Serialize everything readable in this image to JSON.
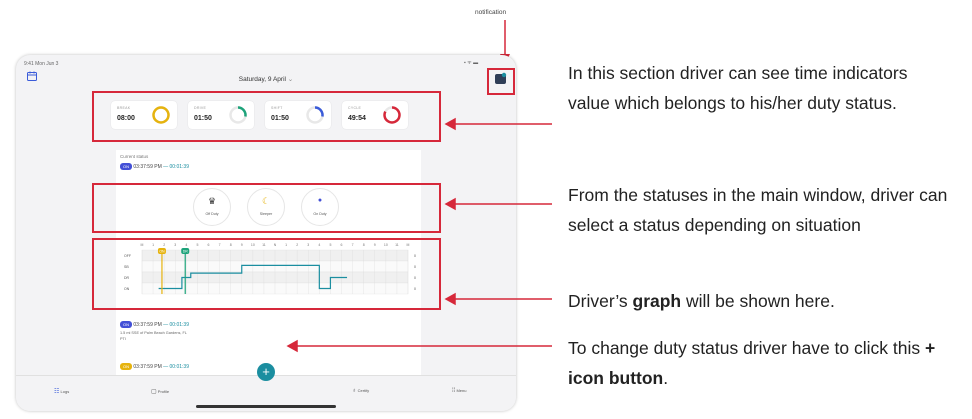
{
  "annotation_label": "notification",
  "tablet": {
    "status_bar": {
      "time": "9:41 Mon Jun 3",
      "icons": "▪︎ ᯤ ▬"
    },
    "date_title": "Saturday, 9 April",
    "date_chevron": "⌄",
    "icons": {
      "calendar": "calendar-icon",
      "notification": "notification-icon"
    },
    "time_indicators": [
      {
        "label": "BREAK",
        "value": "08:00",
        "progress": 1.0,
        "color": "#e6b30e"
      },
      {
        "label": "DRIVE",
        "value": "01:50",
        "progress": 0.28,
        "color": "#1da37a"
      },
      {
        "label": "SHIFT",
        "value": "01:50",
        "progress": 0.28,
        "color": "#3a5bd9"
      },
      {
        "label": "CYCLE",
        "value": "49:54",
        "progress": 0.82,
        "color": "#d6283a"
      }
    ],
    "current_status": {
      "label": "Current status",
      "pill": "ON",
      "time": "03:37:59 PM",
      "separator": "—",
      "duration": "00:01:39"
    },
    "statuses": [
      {
        "label": "Off Duty",
        "icon": "♛",
        "color": "#333333"
      },
      {
        "label": "Sleeper",
        "icon": "☾",
        "color": "#e6b30e"
      },
      {
        "label": "On Duty",
        "icon": "●",
        "color": "#4350d6"
      }
    ],
    "graph": {
      "hours": [
        "M",
        "1",
        "2",
        "3",
        "4",
        "5",
        "6",
        "7",
        "8",
        "9",
        "10",
        "11",
        "N",
        "1",
        "2",
        "3",
        "4",
        "5",
        "6",
        "7",
        "8",
        "9",
        "10",
        "11",
        "M"
      ],
      "rows": [
        "OFF",
        "SB",
        "DR",
        "ON"
      ],
      "marker_labels": [
        "ON",
        "DR"
      ],
      "totals": [
        "0",
        "0",
        "0",
        "0"
      ]
    },
    "log_entries": [
      {
        "pill": "ON",
        "time": "03:37:59 PM",
        "separator": "—",
        "duration": "00:01:39",
        "location": "1.5 mi SSE of Palm Beach Gardens, FL",
        "note": "PTI"
      },
      {
        "pill": "ON",
        "time": "03:37:59 PM",
        "separator": "—",
        "duration": "00:01:39"
      }
    ],
    "fab_label": "+",
    "bottom_nav": [
      {
        "label": "Logs",
        "icon": "logs-icon"
      },
      {
        "label": "Profile",
        "icon": "profile-icon"
      },
      {
        "label": "Certify",
        "icon": "certify-icon"
      },
      {
        "label": "Menu",
        "icon": "menu-icon"
      }
    ]
  },
  "annotations": {
    "time_indicators": "In this section driver can see time indicators value which belongs to his/her duty status.",
    "statuses": "From the statuses in the main window, driver can select a status depending on situation",
    "graph_prefix": "Driver’s ",
    "graph_bold": "graph",
    "graph_suffix": " will be shown here.",
    "button_prefix": "To change duty status driver have to click this ",
    "button_bold": "+ icon button",
    "button_suffix": "."
  },
  "colors": {
    "accent_red": "#d6283a",
    "teal": "#1b8ea0",
    "on_duty_blue": "#4350d6",
    "yellow": "#e6b30e",
    "green": "#1da37a"
  }
}
